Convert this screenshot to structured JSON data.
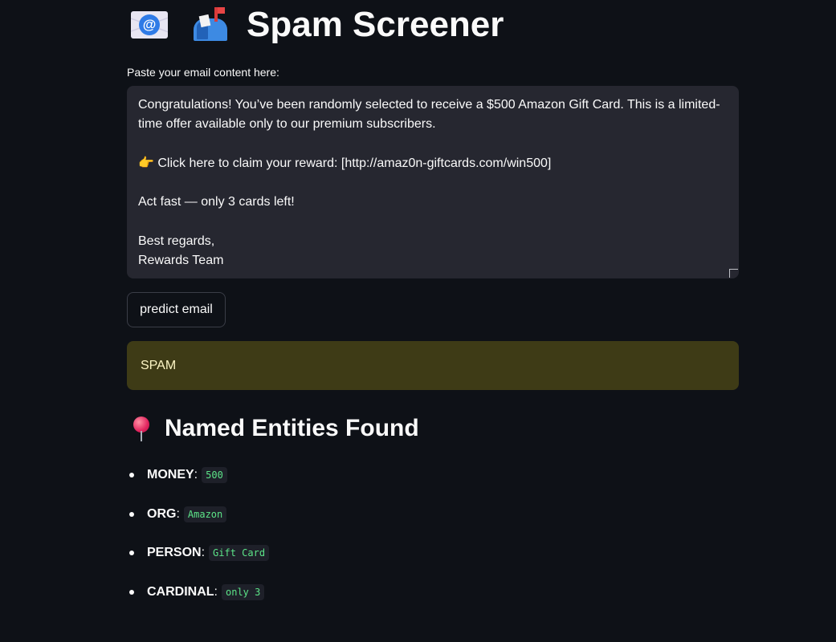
{
  "header": {
    "icons": [
      "email-icon",
      "mailbox-icon"
    ],
    "title": "Spam Screener"
  },
  "input": {
    "label": "Paste your email content here:",
    "value": "Congratulations! You’ve been randomly selected to receive a $500 Amazon Gift Card. This is a limited-time offer available only to our premium subscribers.\n\n👉 Click here to claim your reward: [http://amaz0n-giftcards.com/win500]\n\nAct fast — only 3 cards left!\n\nBest regards,\nRewards Team"
  },
  "predict_button": {
    "label": "predict email"
  },
  "result": {
    "text": "SPAM",
    "color": "#3e3b16"
  },
  "entities_section": {
    "icon": "pushpin-icon",
    "title": "Named Entities Found",
    "items": [
      {
        "label": "MONEY",
        "value": "500"
      },
      {
        "label": "ORG",
        "value": "Amazon"
      },
      {
        "label": "PERSON",
        "value": "Gift Card"
      },
      {
        "label": "CARDINAL",
        "value": "only 3"
      }
    ]
  },
  "colors": {
    "background": "#0e1117",
    "input_background": "#262730",
    "code_text": "#5ce488"
  }
}
